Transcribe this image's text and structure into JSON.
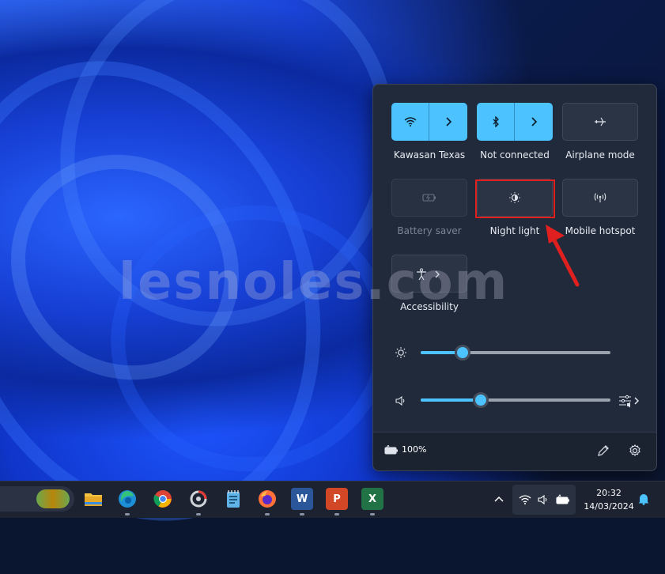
{
  "watermark": "lesnoles.com",
  "colors": {
    "accent": "#4cc2ff",
    "highlight": "#e0201e",
    "panel": "#202a3a"
  },
  "quick_settings": {
    "tiles": [
      {
        "label": "Kawasan Texas",
        "icon": "wifi-icon",
        "state": "on",
        "has_expand": true
      },
      {
        "label": "Not connected",
        "icon": "bluetooth-icon",
        "state": "on",
        "has_expand": true
      },
      {
        "label": "Airplane mode",
        "icon": "airplane-icon",
        "state": "off",
        "has_expand": false
      },
      {
        "label": "Battery saver",
        "icon": "battery-saver-icon",
        "state": "disabled",
        "has_expand": false
      },
      {
        "label": "Night light",
        "icon": "night-light-icon",
        "state": "off",
        "has_expand": false,
        "highlighted": true
      },
      {
        "label": "Mobile hotspot",
        "icon": "hotspot-icon",
        "state": "off",
        "has_expand": false
      },
      {
        "label": "Accessibility",
        "icon": "accessibility-icon",
        "state": "off",
        "has_expand": true
      }
    ],
    "brightness": {
      "icon": "brightness-icon",
      "level": 0.22
    },
    "volume": {
      "icon": "speaker-icon",
      "level": 0.32,
      "mixer_icon": "audio-mixer-icon"
    },
    "footer": {
      "battery_text": "100%",
      "edit_icon": "pencil-icon",
      "settings_icon": "gear-icon"
    }
  },
  "taskbar": {
    "apps": [
      "widgets-icon",
      "file-explorer-icon",
      "edge-icon",
      "chrome-icon",
      "recorder-icon",
      "notepad-icon",
      "firefox-icon",
      "word-icon",
      "powerpoint-icon",
      "excel-icon"
    ],
    "tray": {
      "time": "20:32",
      "date": "14/03/2024"
    }
  }
}
